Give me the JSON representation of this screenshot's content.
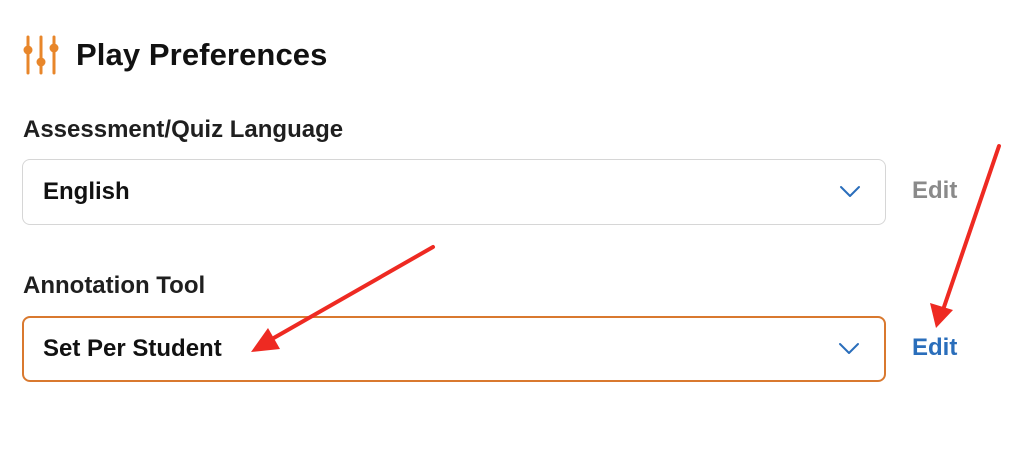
{
  "header": {
    "title": "Play Preferences",
    "icon": "sliders-icon",
    "icon_color": "#e8862a"
  },
  "fields": [
    {
      "label": "Assessment/Quiz Language",
      "value": "English",
      "edit_label": "Edit",
      "edit_state": "disabled",
      "edit_color": "#8a8a8a"
    },
    {
      "label": "Annotation Tool",
      "value": "Set Per Student",
      "edit_label": "Edit",
      "edit_state": "enabled",
      "edit_color": "#2a6ebb",
      "border_color": "#d9792f"
    }
  ],
  "colors": {
    "chevron": "#2a6ebb",
    "annotation_arrow": "#ee2a22"
  }
}
